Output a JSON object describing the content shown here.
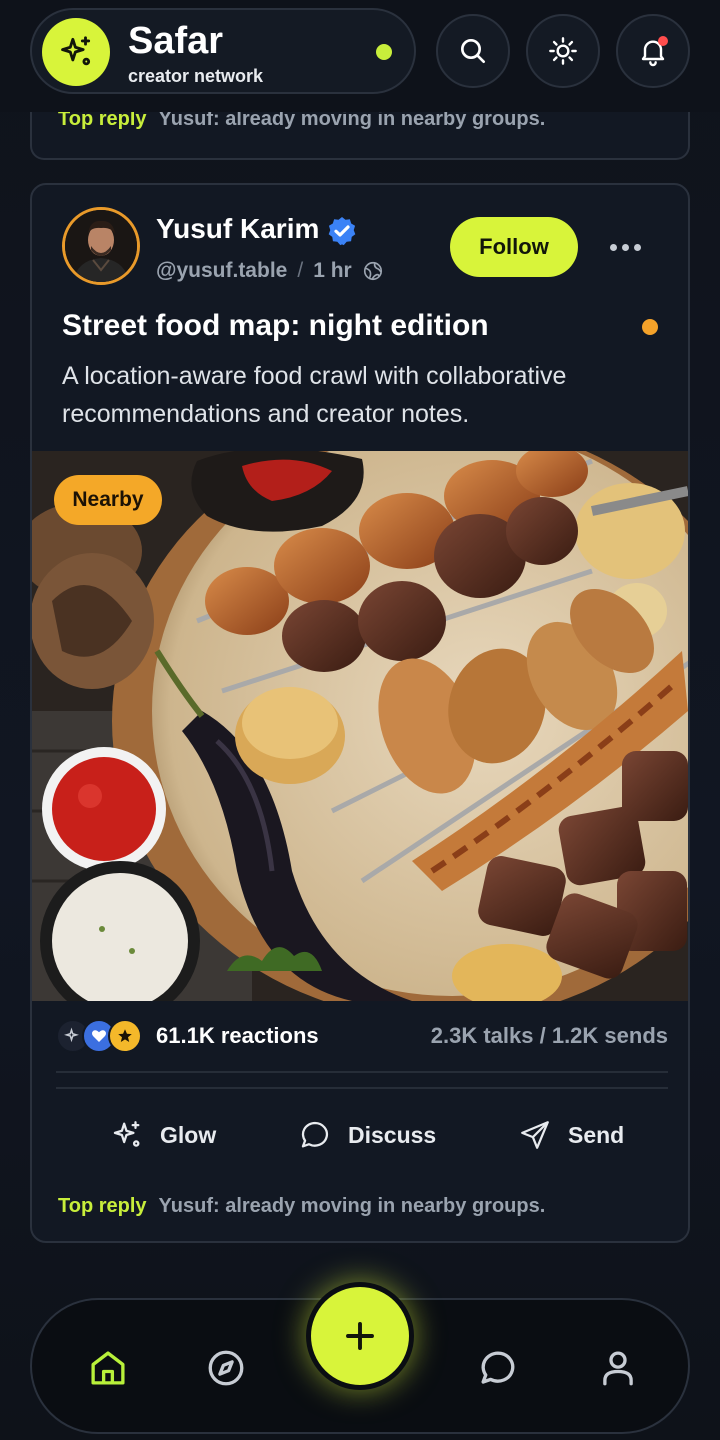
{
  "colors": {
    "accent": "#d8f43a",
    "background": "#0e121a",
    "card": "#121823",
    "nearby_badge": "#f4a828",
    "notification_dot": "#ff4d4d",
    "verified": "#3b82f6"
  },
  "header": {
    "brand_name": "Safar",
    "brand_sub": "creator network",
    "logo_icon": "sparkles-icon",
    "buttons": [
      "search-icon",
      "sun-icon",
      "bell-icon"
    ]
  },
  "previous_card": {
    "top_reply_label": "Top reply",
    "top_reply_text": "Yusuf: already moving in nearby groups."
  },
  "post": {
    "author_name": "Yusuf Karim",
    "handle": "@yusuf.table",
    "separator": "/",
    "time": "1 hr",
    "visibility_icon": "globe-icon",
    "follow_label": "Follow",
    "title": "Street food map: night edition",
    "description": "A location-aware food crawl with collaborative recommendations and creator notes.",
    "badge": "Nearby",
    "reactions": "61.1K reactions",
    "talks_sends": "2.3K talks / 1.2K sends",
    "actions": [
      {
        "label": "Glow",
        "icon": "sparkles-icon"
      },
      {
        "label": "Discuss",
        "icon": "chat-bubble-icon"
      },
      {
        "label": "Send",
        "icon": "send-icon"
      }
    ],
    "top_reply_label": "Top reply",
    "top_reply_text": "Yusuf: already moving in nearby groups."
  },
  "bottom_nav": {
    "items": [
      "home-icon",
      "compass-icon",
      "chat-icon",
      "profile-icon"
    ],
    "fab_icon": "plus-icon"
  }
}
